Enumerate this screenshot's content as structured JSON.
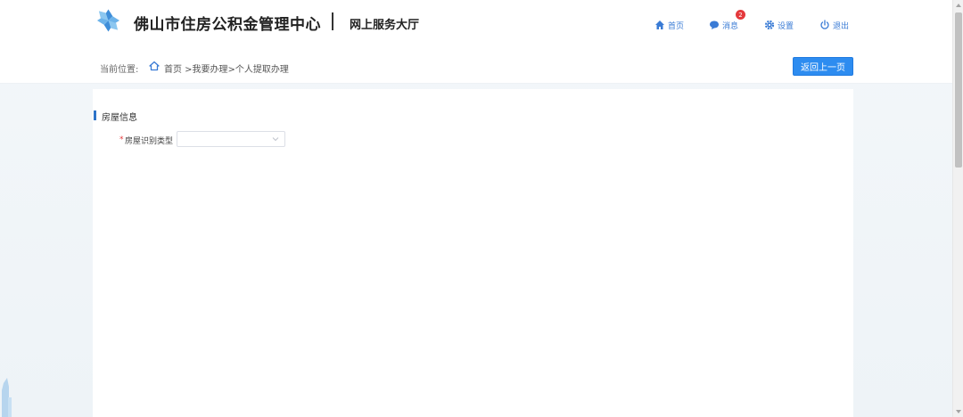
{
  "header": {
    "site_title": "佛山市住房公积金管理中心",
    "site_subtitle": "网上服务大厅",
    "nav": {
      "home_label": "首页",
      "messages_label": "消息",
      "messages_badge": "2",
      "settings_label": "设置",
      "logout_label": "退出"
    }
  },
  "breadcrumb": {
    "label": "当前位置:",
    "path": "首页 >我要办理>个人提取办理"
  },
  "actions": {
    "back_label": "返回上一页"
  },
  "form": {
    "section_title": "房屋信息",
    "required_mark": "*",
    "field_label": "房屋识别类型",
    "field_value": ""
  },
  "colors": {
    "accent": "#2d8cf0",
    "nav_text": "#3a7bd5",
    "badge": "#e4393c"
  },
  "icons": [
    "logo-icon",
    "home-icon",
    "message-icon",
    "gear-icon",
    "power-icon",
    "chevron-down-icon"
  ]
}
